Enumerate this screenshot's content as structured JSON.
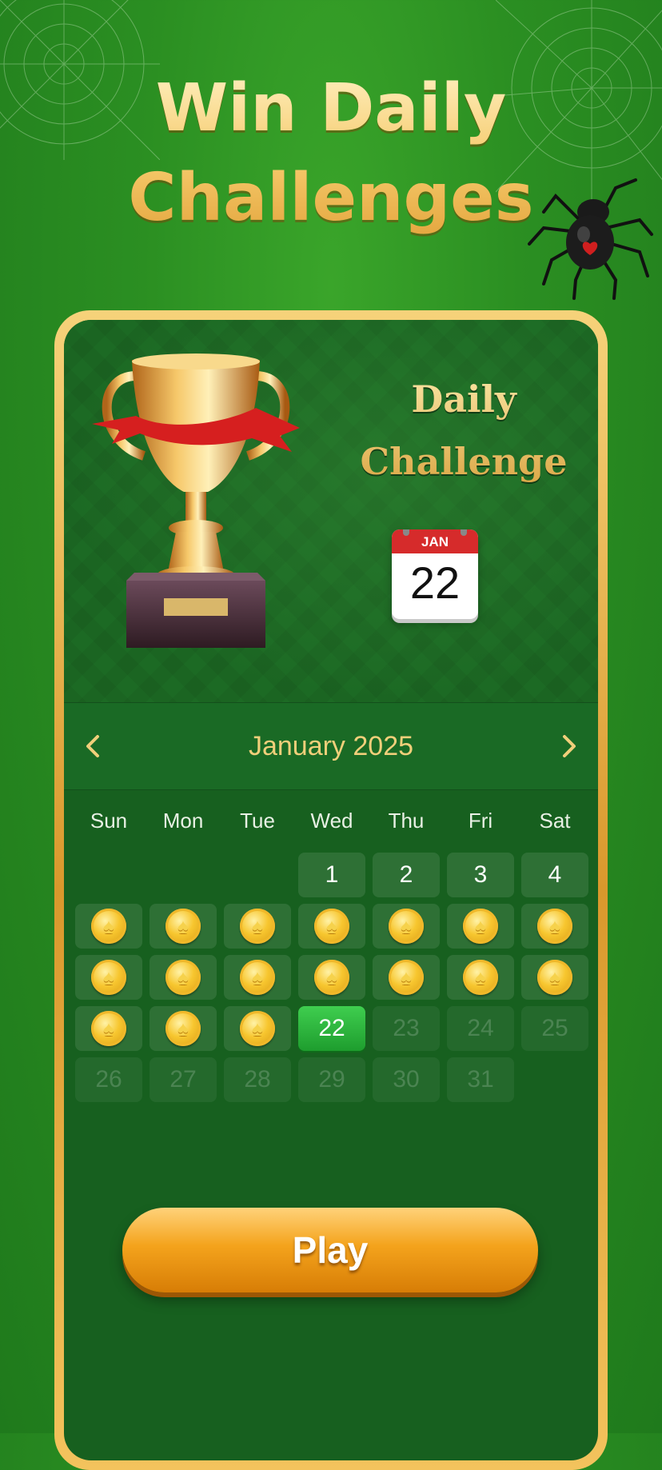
{
  "headline": {
    "line1": "Win Daily",
    "line2": "Challenges"
  },
  "hero": {
    "title_line1": "Daily",
    "title_line2": "Challenge",
    "calendar_month": "JAN",
    "calendar_day": "22"
  },
  "calendar": {
    "month_label": "January 2025",
    "weekdays": [
      "Sun",
      "Mon",
      "Tue",
      "Wed",
      "Thu",
      "Fri",
      "Sat"
    ],
    "first_weekday_index": 3,
    "days_in_month": 31,
    "today": 22,
    "completed_days": [
      5,
      6,
      7,
      8,
      9,
      10,
      11,
      12,
      13,
      14,
      15,
      16,
      17,
      18,
      19,
      20,
      21
    ],
    "available_days": [
      1,
      2,
      3,
      4
    ],
    "locked_days": [
      23,
      24,
      25,
      26,
      27,
      28,
      29,
      30,
      31
    ]
  },
  "play_button": {
    "label": "Play"
  },
  "icons": {
    "prev": "chevron-left-icon",
    "next": "chevron-right-icon",
    "completed": "gold-spade-coin-icon"
  },
  "colors": {
    "background": "#2b8f22",
    "panel": "#17601f",
    "gold": "#f0cf7a",
    "today": "#2db53c",
    "play": "#f4a31c"
  }
}
